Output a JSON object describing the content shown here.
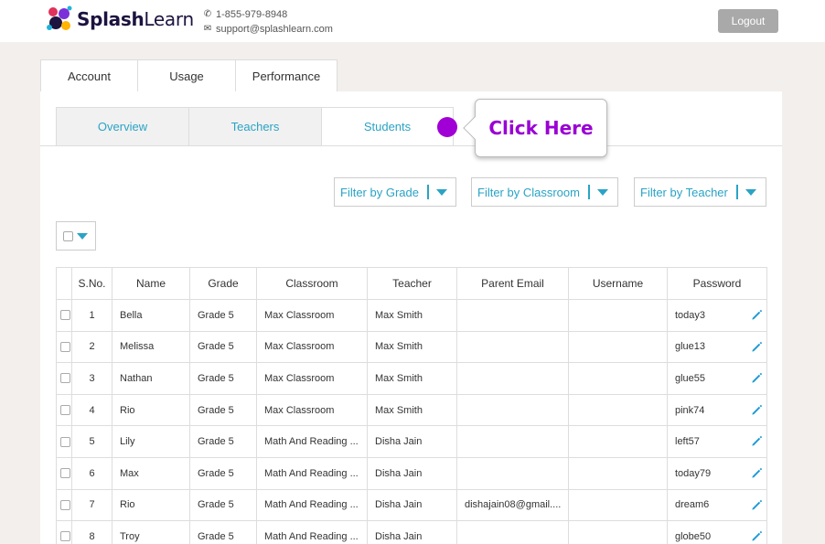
{
  "header": {
    "logo_text_bold": "Splash",
    "logo_text_light": "Learn",
    "phone": "1-855-979-8948",
    "email": "support@splashlearn.com",
    "logout_label": "Logout"
  },
  "top_tabs": [
    {
      "label": "Account"
    },
    {
      "label": "Usage"
    },
    {
      "label": "Performance"
    }
  ],
  "sub_tabs": [
    {
      "label": "Overview"
    },
    {
      "label": "Teachers"
    },
    {
      "label": "Students",
      "active": true
    }
  ],
  "callout": {
    "label": "Click Here"
  },
  "filters": [
    {
      "label": "Filter by Grade"
    },
    {
      "label": "Filter by Classroom"
    },
    {
      "label": "Filter by Teacher"
    }
  ],
  "table": {
    "columns": [
      "",
      "S.No.",
      "Name",
      "Grade",
      "Classroom",
      "Teacher",
      "Parent Email",
      "Username",
      "Password"
    ],
    "rows": [
      {
        "sno": "1",
        "name": "Bella",
        "grade": "Grade 5",
        "classroom": "Max Classroom",
        "teacher": "Max Smith",
        "parent_email": "",
        "username": "",
        "password": "today3"
      },
      {
        "sno": "2",
        "name": "Melissa",
        "grade": "Grade 5",
        "classroom": "Max Classroom",
        "teacher": "Max Smith",
        "parent_email": "",
        "username": "",
        "password": "glue13"
      },
      {
        "sno": "3",
        "name": "Nathan",
        "grade": "Grade 5",
        "classroom": "Max Classroom",
        "teacher": "Max Smith",
        "parent_email": "",
        "username": "",
        "password": "glue55"
      },
      {
        "sno": "4",
        "name": "Rio",
        "grade": "Grade 5",
        "classroom": "Max Classroom",
        "teacher": "Max Smith",
        "parent_email": "",
        "username": "",
        "password": "pink74"
      },
      {
        "sno": "5",
        "name": "Lily",
        "grade": "Grade 5",
        "classroom": "Math And Reading ...",
        "teacher": "Disha Jain",
        "parent_email": "",
        "username": "",
        "password": "left57"
      },
      {
        "sno": "6",
        "name": "Max",
        "grade": "Grade 5",
        "classroom": "Math And Reading ...",
        "teacher": "Disha Jain",
        "parent_email": "",
        "username": "",
        "password": "today79"
      },
      {
        "sno": "7",
        "name": "Rio",
        "grade": "Grade 5",
        "classroom": "Math And Reading ...",
        "teacher": "Disha Jain",
        "parent_email": "dishajain08@gmail....",
        "username": "",
        "password": "dream6"
      },
      {
        "sno": "8",
        "name": "Troy",
        "grade": "Grade 5",
        "classroom": "Math And Reading ...",
        "teacher": "Disha Jain",
        "parent_email": "",
        "username": "",
        "password": "globe50"
      }
    ]
  },
  "colors": {
    "accent": "#2aa3c5",
    "callout": "#9a00d4",
    "logout_bg": "#a9a9a9",
    "page_bg": "#f3efec"
  },
  "icons": {
    "phone": "phone-icon",
    "email": "envelope-icon",
    "edit": "pencil-icon",
    "dropdown": "caret-down-icon"
  }
}
